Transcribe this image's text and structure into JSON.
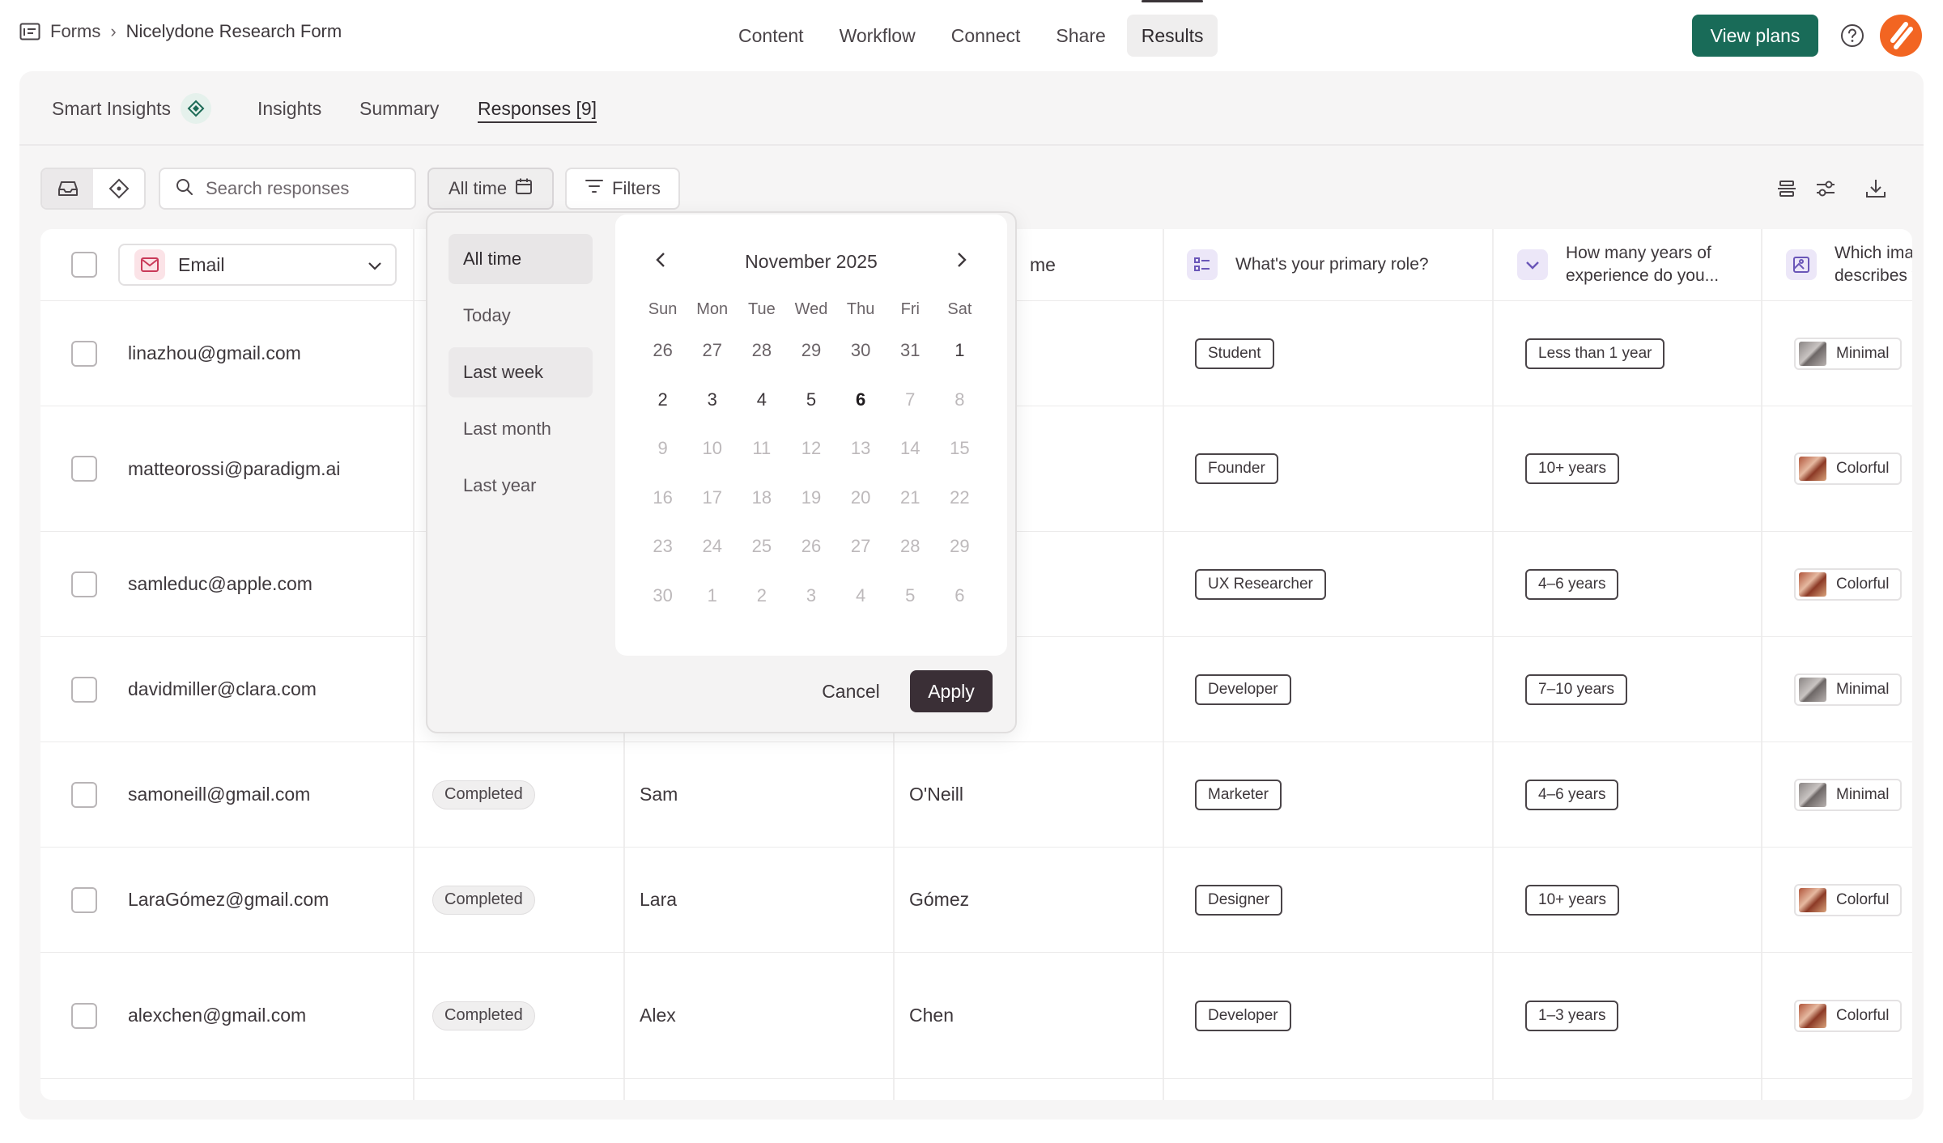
{
  "breadcrumb": {
    "root": "Forms",
    "separator": "›",
    "current": "Nicelydone Research Form"
  },
  "top_nav": [
    "Content",
    "Workflow",
    "Connect",
    "Share",
    "Results"
  ],
  "top_nav_active": "Results",
  "header": {
    "plans_button": "View plans"
  },
  "sub_tabs": {
    "smart_insights": "Smart Insights",
    "insights": "Insights",
    "summary": "Summary",
    "responses": "Responses [9]"
  },
  "toolbar": {
    "search_placeholder": "Search responses",
    "date_button": "All time",
    "filters_button": "Filters"
  },
  "date_picker": {
    "presets": [
      "All time",
      "Today",
      "Last week",
      "Last month",
      "Last year"
    ],
    "active_preset": "All time",
    "month_label": "November 2025",
    "weekdays": [
      "Sun",
      "Mon",
      "Tue",
      "Wed",
      "Thu",
      "Fri",
      "Sat"
    ],
    "days": [
      {
        "d": "26",
        "s": "muted"
      },
      {
        "d": "27",
        "s": "muted"
      },
      {
        "d": "28",
        "s": "muted"
      },
      {
        "d": "29",
        "s": "muted"
      },
      {
        "d": "30",
        "s": "muted"
      },
      {
        "d": "31",
        "s": "muted"
      },
      {
        "d": "1",
        "s": "cur"
      },
      {
        "d": "2",
        "s": "cur"
      },
      {
        "d": "3",
        "s": "cur"
      },
      {
        "d": "4",
        "s": "cur"
      },
      {
        "d": "5",
        "s": "cur"
      },
      {
        "d": "6",
        "s": "today"
      },
      {
        "d": "7",
        "s": "dis"
      },
      {
        "d": "8",
        "s": "dis"
      },
      {
        "d": "9",
        "s": "dis"
      },
      {
        "d": "10",
        "s": "dis"
      },
      {
        "d": "11",
        "s": "dis"
      },
      {
        "d": "12",
        "s": "dis"
      },
      {
        "d": "13",
        "s": "dis"
      },
      {
        "d": "14",
        "s": "dis"
      },
      {
        "d": "15",
        "s": "dis"
      },
      {
        "d": "16",
        "s": "dis"
      },
      {
        "d": "17",
        "s": "dis"
      },
      {
        "d": "18",
        "s": "dis"
      },
      {
        "d": "19",
        "s": "dis"
      },
      {
        "d": "20",
        "s": "dis"
      },
      {
        "d": "21",
        "s": "dis"
      },
      {
        "d": "22",
        "s": "dis"
      },
      {
        "d": "23",
        "s": "dis"
      },
      {
        "d": "24",
        "s": "dis"
      },
      {
        "d": "25",
        "s": "dis"
      },
      {
        "d": "26",
        "s": "dis"
      },
      {
        "d": "27",
        "s": "dis"
      },
      {
        "d": "28",
        "s": "dis"
      },
      {
        "d": "29",
        "s": "dis"
      },
      {
        "d": "30",
        "s": "dis"
      },
      {
        "d": "1",
        "s": "dis"
      },
      {
        "d": "2",
        "s": "dis"
      },
      {
        "d": "3",
        "s": "dis"
      },
      {
        "d": "4",
        "s": "dis"
      },
      {
        "d": "5",
        "s": "dis"
      },
      {
        "d": "6",
        "s": "dis"
      }
    ],
    "cancel": "Cancel",
    "apply": "Apply"
  },
  "table": {
    "email_column": "Email",
    "partial_header": "me",
    "columns": [
      "What's your primary role?",
      "How many years of experience do you...",
      "Which imag describes y"
    ],
    "rows": [
      {
        "email": "linazhou@gmail.com",
        "status": "",
        "first": "",
        "last": "",
        "role": "Student",
        "years": "Less than 1 year",
        "style": "Minimal"
      },
      {
        "email": "matteorossi@paradigm.ai",
        "status": "",
        "first": "",
        "last": "",
        "role": "Founder",
        "years": "10+ years",
        "style": "Colorful"
      },
      {
        "email": "samleduc@apple.com",
        "status": "",
        "first": "",
        "last": "",
        "role": "UX Researcher",
        "years": "4–6 years",
        "style": "Colorful"
      },
      {
        "email": "davidmiller@clara.com",
        "status": "",
        "first": "",
        "last": "",
        "role": "Developer",
        "years": "7–10 years",
        "style": "Minimal"
      },
      {
        "email": "samoneill@gmail.com",
        "status": "Completed",
        "first": "Sam",
        "last": "O'Neill",
        "role": "Marketer",
        "years": "4–6 years",
        "style": "Minimal"
      },
      {
        "email": "LaraGómez@gmail.com",
        "status": "Completed",
        "first": "Lara",
        "last": "Gómez",
        "role": "Designer",
        "years": "10+ years",
        "style": "Colorful"
      },
      {
        "email": "alexchen@gmail.com",
        "status": "Completed",
        "first": "Alex",
        "last": "Chen",
        "role": "Developer",
        "years": "1–3 years",
        "style": "Colorful"
      }
    ]
  },
  "colors": {
    "brand_primary": "#196b58",
    "brand_logo": "#f26522",
    "apply_button": "#3a2f36"
  }
}
